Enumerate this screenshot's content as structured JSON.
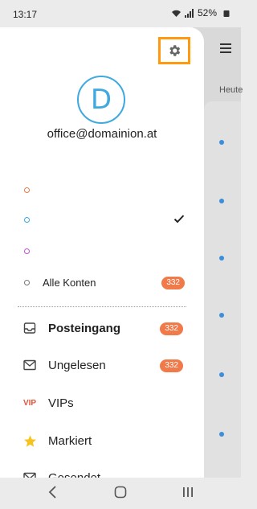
{
  "status": {
    "time": "13:17",
    "battery": "52%"
  },
  "drawer": {
    "avatar_letter": "D",
    "email": "office@domainion.at",
    "accounts": [
      {
        "label": "",
        "ring_color": "#e97a44"
      },
      {
        "label": "",
        "ring_color": "#3fa9e0",
        "checked": true
      },
      {
        "label": "",
        "ring_color": "#c04fd0"
      },
      {
        "label": "Alle Konten",
        "ring_color": "#777777",
        "badge": "332"
      }
    ],
    "folders": [
      {
        "label": "Posteingang",
        "icon": "inbox-icon",
        "badge": "332",
        "bold": true
      },
      {
        "label": "Ungelesen",
        "icon": "envelope-icon",
        "badge": "332"
      },
      {
        "label": "VIPs",
        "icon": "vip-icon",
        "icon_text": "VIP"
      },
      {
        "label": "Markiert",
        "icon": "star-icon"
      },
      {
        "label": "Gesendet",
        "icon": "sent-icon"
      }
    ]
  },
  "background": {
    "section_label": "Heute"
  },
  "colors": {
    "accent": "#3fa9e0",
    "badge": "#f07a4a",
    "highlight": "#ff9a10",
    "star": "#f7c21b"
  }
}
